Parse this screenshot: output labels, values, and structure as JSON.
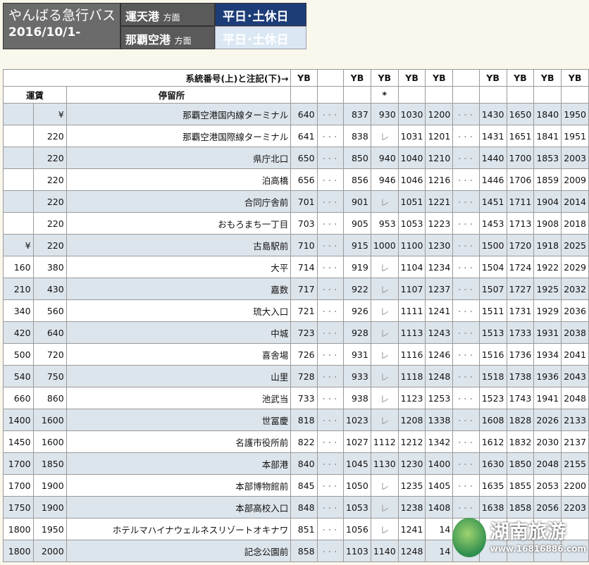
{
  "header": {
    "title": "やんばる急行バス",
    "date": "2016/10/1-",
    "dest1": "運天港",
    "dest2": "那覇空港",
    "dir": "方面",
    "day_active": "平日･土休日",
    "day_inactive": "平日･土休日"
  },
  "table": {
    "route_label": "系統番号(上)と注記(下)→",
    "fare_label": "運賃",
    "stop_label": "停留所",
    "col_headers": [
      "YB",
      "",
      "YB",
      "YB",
      "YB",
      "YB",
      "",
      "YB",
      "YB",
      "YB",
      "YB"
    ],
    "col_notes": [
      "",
      "",
      "",
      "*",
      "",
      "",
      "",
      "",
      "",
      "",
      ""
    ],
    "rows": [
      {
        "f1": "",
        "f2": "¥",
        "stop": "那覇空港国内線ターミナル",
        "t": [
          "640",
          "･･･",
          "837",
          "930",
          "1030",
          "1200",
          "･･･",
          "1430",
          "1650",
          "1840",
          "1950"
        ]
      },
      {
        "f1": "",
        "f2": "220",
        "stop": "那覇空港国際線ターミナル",
        "t": [
          "641",
          "･･･",
          "838",
          "レ",
          "1031",
          "1201",
          "･･･",
          "1431",
          "1651",
          "1841",
          "1951"
        ]
      },
      {
        "f1": "",
        "f2": "220",
        "stop": "県庁北口",
        "t": [
          "650",
          "･･･",
          "850",
          "940",
          "1040",
          "1210",
          "･･･",
          "1440",
          "1700",
          "1853",
          "2003"
        ]
      },
      {
        "f1": "",
        "f2": "220",
        "stop": "泊高橋",
        "t": [
          "656",
          "･･･",
          "856",
          "946",
          "1046",
          "1216",
          "･･･",
          "1446",
          "1706",
          "1859",
          "2009"
        ]
      },
      {
        "f1": "",
        "f2": "220",
        "stop": "合同庁舎前",
        "t": [
          "701",
          "･･･",
          "901",
          "レ",
          "1051",
          "1221",
          "･･･",
          "1451",
          "1711",
          "1904",
          "2014"
        ]
      },
      {
        "f1": "",
        "f2": "220",
        "stop": "おもろまち一丁目",
        "t": [
          "703",
          "･･･",
          "905",
          "953",
          "1053",
          "1223",
          "･･･",
          "1453",
          "1713",
          "1908",
          "2018"
        ]
      },
      {
        "f1": "¥",
        "f2": "220",
        "stop": "古島駅前",
        "t": [
          "710",
          "･･･",
          "915",
          "1000",
          "1100",
          "1230",
          "･･･",
          "1500",
          "1720",
          "1918",
          "2025"
        ]
      },
      {
        "f1": "160",
        "f2": "380",
        "stop": "大平",
        "t": [
          "714",
          "･･･",
          "919",
          "レ",
          "1104",
          "1234",
          "･･･",
          "1504",
          "1724",
          "1922",
          "2029"
        ]
      },
      {
        "f1": "210",
        "f2": "430",
        "stop": "嘉数",
        "t": [
          "717",
          "･･･",
          "922",
          "レ",
          "1107",
          "1237",
          "･･･",
          "1507",
          "1727",
          "1925",
          "2032"
        ]
      },
      {
        "f1": "340",
        "f2": "560",
        "stop": "琉大入口",
        "t": [
          "721",
          "･･･",
          "926",
          "レ",
          "1111",
          "1241",
          "･･･",
          "1511",
          "1731",
          "1929",
          "2036"
        ]
      },
      {
        "f1": "420",
        "f2": "640",
        "stop": "中城",
        "t": [
          "723",
          "･･･",
          "928",
          "レ",
          "1113",
          "1243",
          "･･･",
          "1513",
          "1733",
          "1931",
          "2038"
        ]
      },
      {
        "f1": "500",
        "f2": "720",
        "stop": "喜舎場",
        "t": [
          "726",
          "･･･",
          "931",
          "レ",
          "1116",
          "1246",
          "･･･",
          "1516",
          "1736",
          "1934",
          "2041"
        ]
      },
      {
        "f1": "540",
        "f2": "750",
        "stop": "山里",
        "t": [
          "728",
          "･･･",
          "933",
          "レ",
          "1118",
          "1248",
          "･･･",
          "1518",
          "1738",
          "1936",
          "2043"
        ]
      },
      {
        "f1": "660",
        "f2": "860",
        "stop": "池武当",
        "t": [
          "733",
          "･･･",
          "938",
          "レ",
          "1123",
          "1253",
          "･･･",
          "1523",
          "1743",
          "1941",
          "2048"
        ]
      },
      {
        "f1": "1400",
        "f2": "1600",
        "stop": "世冨慶",
        "t": [
          "818",
          "･･･",
          "1023",
          "レ",
          "1208",
          "1338",
          "･･･",
          "1608",
          "1828",
          "2026",
          "2133"
        ]
      },
      {
        "f1": "1450",
        "f2": "1600",
        "stop": "名護市役所前",
        "t": [
          "822",
          "･･･",
          "1027",
          "1112",
          "1212",
          "1342",
          "･･･",
          "1612",
          "1832",
          "2030",
          "2137"
        ]
      },
      {
        "f1": "1700",
        "f2": "1850",
        "stop": "本部港",
        "t": [
          "840",
          "･･･",
          "1045",
          "1130",
          "1230",
          "1400",
          "･･･",
          "1630",
          "1850",
          "2048",
          "2155"
        ]
      },
      {
        "f1": "1700",
        "f2": "1900",
        "stop": "本部博物館前",
        "t": [
          "845",
          "･･･",
          "1050",
          "レ",
          "1235",
          "1405",
          "･･･",
          "1635",
          "1855",
          "2053",
          "2200"
        ]
      },
      {
        "f1": "1750",
        "f2": "1900",
        "stop": "本部高校入口",
        "t": [
          "848",
          "･･･",
          "1053",
          "レ",
          "1238",
          "1408",
          "･･･",
          "1638",
          "1858",
          "2056",
          "2203"
        ]
      },
      {
        "f1": "1800",
        "f2": "1950",
        "stop": "ホテルマハイナウェルネスリゾートオキナワ",
        "t": [
          "851",
          "･･･",
          "1056",
          "レ",
          "1241",
          "14",
          "",
          "",
          "",
          "",
          ""
        ]
      },
      {
        "f1": "1800",
        "f2": "2000",
        "stop": "記念公園前",
        "t": [
          "858",
          "･･･",
          "1103",
          "1140",
          "1248",
          "14",
          "",
          "",
          "",
          "",
          ""
        ]
      }
    ]
  },
  "watermark": {
    "name": "湖南旅游",
    "url": "www.16816886.com"
  }
}
